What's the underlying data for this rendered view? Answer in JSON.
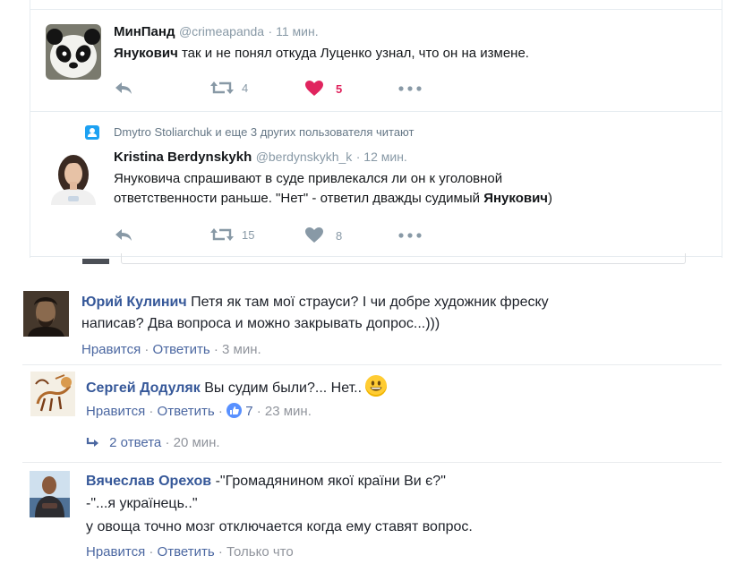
{
  "twitter": {
    "tweets": [
      {
        "name": "МинПанд",
        "handle": "@crimeapanda",
        "time": "· 11 мин.",
        "text_bold": "Янукович",
        "text_rest": " так и не понял откуда Луценко узнал, что он на измене.",
        "retweets": "4",
        "likes": "5",
        "liked": true
      },
      {
        "context": "Dmytro Stoliarchuk и еще 3 других пользователя читают",
        "name": "Kristina Berdynskykh",
        "handle": "@berdynskykh_k",
        "time": "· 12 мин.",
        "text_line1": "Януковича спрашивают в суде привлекался ли он к уголовной",
        "text_line2_pre": "ответственности раньше. \"Нет\" - ответил дважды судимый ",
        "text_line2_bold": "Янукович",
        "text_line2_post": ")",
        "retweets": "15",
        "likes": "8",
        "liked": false
      }
    ]
  },
  "facebook": {
    "comments": [
      {
        "name": "Юрий Кулинич",
        "line1": " Петя як там мої страуси? І чи добре художник фреску",
        "line2": "написав? Два вопроса и можно закрывать допрос...)))",
        "like_label": "Нравится",
        "reply_label": "Ответить",
        "time": "3 мин."
      },
      {
        "name": "Сергей Додуляк",
        "line1": " Вы судим были?... Нет..",
        "like_label": "Нравится",
        "reply_label": "Ответить",
        "reactions": "7",
        "time": "23 мин.",
        "replies_label": "2 ответа",
        "replies_time": "20 мин."
      },
      {
        "name": "Вячеслав Орехов",
        "line1": " -\"Громадянином якої країни Ви є?\"",
        "line2": "-\"...я українець..\"",
        "line3": "у овоща точно мозг отключается когда ему ставят вопрос.",
        "like_label": "Нравится",
        "reply_label": "Ответить",
        "time": "Только что"
      }
    ]
  },
  "colors": {
    "twitter_gray": "#8899a6",
    "twitter_like": "#e0245e",
    "twitter_blue": "#1da1f2",
    "fb_name": "#365899",
    "fb_link": "#4b67a1",
    "fb_meta": "#90949c"
  },
  "icons": [
    "reply-icon",
    "retweet-icon",
    "heart-icon",
    "more-icon",
    "follow-context-icon",
    "reply-arrow-icon",
    "like-reaction-icon",
    "smile-emoji-icon"
  ]
}
